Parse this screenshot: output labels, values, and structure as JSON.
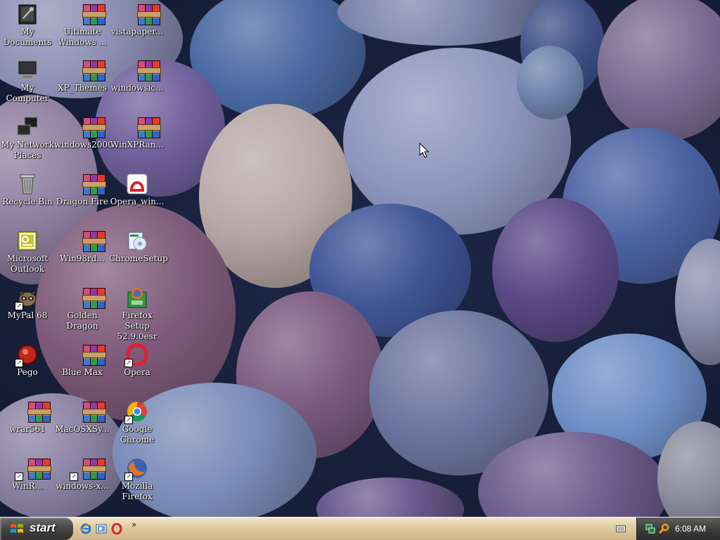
{
  "desktop": {
    "icons": [
      {
        "id": "my-documents",
        "label": "My Documents"
      },
      {
        "id": "ultimate-windows",
        "label": "Ultimate Windows ..."
      },
      {
        "id": "vistapapers",
        "label": "vistapaper..."
      },
      {
        "id": "my-computer",
        "label": "My Computer"
      },
      {
        "id": "xp-themes",
        "label": "XP_Themes"
      },
      {
        "id": "windowsic",
        "label": "windowsic..."
      },
      {
        "id": "my-network-places",
        "label": "My Network Places"
      },
      {
        "id": "windows2000",
        "label": "windows2000"
      },
      {
        "id": "winxpran",
        "label": "WinXPRan..."
      },
      {
        "id": "recycle-bin",
        "label": "Recycle Bin"
      },
      {
        "id": "dragon-fire",
        "label": "Dragon Fire"
      },
      {
        "id": "opera-win",
        "label": "Opera_win..."
      },
      {
        "id": "microsoft-outlook",
        "label": "Microsoft Outlook"
      },
      {
        "id": "win98rd",
        "label": "Win98rd..."
      },
      {
        "id": "chromesetup",
        "label": "ChromeSetup"
      },
      {
        "id": "mypal",
        "label": "MyPal 68"
      },
      {
        "id": "golden-dragon",
        "label": "Golden Dragon"
      },
      {
        "id": "firefox-setup",
        "label": "Firefox Setup 52.9.0esr"
      },
      {
        "id": "pego",
        "label": "Pego"
      },
      {
        "id": "blue-max",
        "label": "Blue Max"
      },
      {
        "id": "opera",
        "label": "Opera"
      },
      {
        "id": "wrar561",
        "label": "wrar561"
      },
      {
        "id": "macosxsy",
        "label": "MacOSXSy..."
      },
      {
        "id": "google-chrome",
        "label": "Google Chrome"
      },
      {
        "id": "winr",
        "label": "WinR..."
      },
      {
        "id": "windows-x",
        "label": "windows-x..."
      },
      {
        "id": "mozilla-firefox",
        "label": "Mozilla Firefox"
      }
    ]
  },
  "taskbar": {
    "start_label": "start",
    "quick_launch": [
      "internet-explorer-icon",
      "show-desktop-icon",
      "opera-icon"
    ],
    "overflow_label": "»",
    "clock": "6:08 AM"
  },
  "colors": {
    "taskbar": "#dfcaa0",
    "start_button": "#454545",
    "tray": "#3e3e3e"
  }
}
